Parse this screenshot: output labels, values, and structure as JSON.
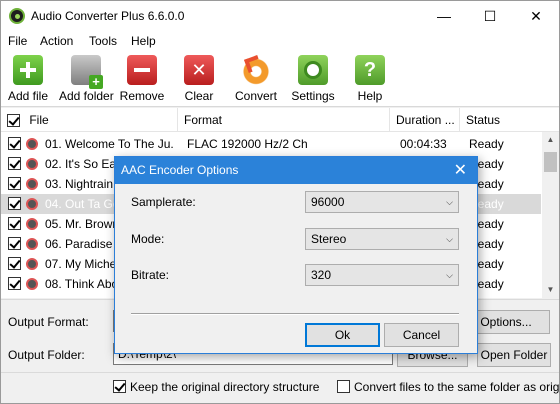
{
  "window": {
    "title": "Audio Converter Plus 6.6.0.0",
    "controls": {
      "minimize": "—",
      "maximize": "☐",
      "close": "✕"
    }
  },
  "menu": [
    "File",
    "Action",
    "Tools",
    "Help"
  ],
  "toolbar": [
    {
      "label": "Add file",
      "icon": "add-file-icon"
    },
    {
      "label": "Add folder",
      "icon": "add-folder-icon"
    },
    {
      "label": "Remove",
      "icon": "remove-icon"
    },
    {
      "label": "Clear",
      "icon": "clear-icon"
    },
    {
      "label": "Convert",
      "icon": "convert-icon"
    },
    {
      "label": "Settings",
      "icon": "settings-icon"
    },
    {
      "label": "Help",
      "icon": "help-icon"
    }
  ],
  "file_list": {
    "columns": [
      "File",
      "Format",
      "Duration ...",
      "Status"
    ],
    "rows": [
      {
        "name": "01. Welcome To The Ju...",
        "format": "FLAC 192000 Hz/2 Ch",
        "duration": "00:04:33",
        "status": "Ready",
        "checked": true,
        "selected": false
      },
      {
        "name": "02. It's So Eas",
        "format": "",
        "duration": "",
        "status": "Ready",
        "checked": true,
        "selected": false
      },
      {
        "name": "03. Nightrain",
        "format": "",
        "duration": "",
        "status": "Ready",
        "checked": true,
        "selected": false
      },
      {
        "name": "04. Out Ta Ge",
        "format": "",
        "duration": "",
        "status": "Ready",
        "checked": true,
        "selected": true
      },
      {
        "name": "05. Mr. Browns",
        "format": "",
        "duration": "",
        "status": "Ready",
        "checked": true,
        "selected": false
      },
      {
        "name": "06. Paradise C",
        "format": "",
        "duration": "",
        "status": "Ready",
        "checked": true,
        "selected": false
      },
      {
        "name": "07. My Michelle",
        "format": "",
        "duration": "",
        "status": "Ready",
        "checked": true,
        "selected": false
      },
      {
        "name": "08. Think Abou",
        "format": "",
        "duration": "",
        "status": "Ready",
        "checked": true,
        "selected": false
      }
    ]
  },
  "output": {
    "format_label": "Output Format:",
    "options_button": "Options...",
    "folder_label": "Output Folder:",
    "folder_value": "D:\\Temp\\2\\",
    "browse_button": "Browse...",
    "open_folder_button": "Open Folder"
  },
  "options": {
    "keep_structure": {
      "label": "Keep the original directory structure",
      "checked": true
    },
    "same_folder": {
      "label": "Convert files to the same folder as original",
      "checked": false
    }
  },
  "dialog": {
    "title": "AAC Encoder Options",
    "fields": [
      {
        "label": "Samplerate:",
        "value": "96000"
      },
      {
        "label": "Mode:",
        "value": "Stereo"
      },
      {
        "label": "Bitrate:",
        "value": "320"
      }
    ],
    "ok": "Ok",
    "cancel": "Cancel",
    "close": "✕"
  }
}
